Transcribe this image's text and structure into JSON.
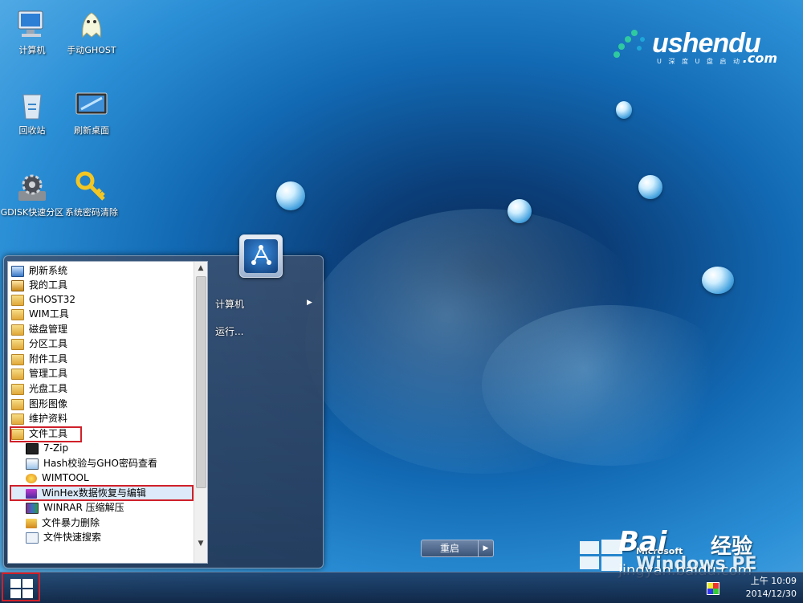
{
  "desktop": {
    "icons": [
      {
        "label": "计算机"
      },
      {
        "label": "手动GHOST"
      },
      {
        "label": "回收站"
      },
      {
        "label": "刷新桌面"
      },
      {
        "label": "GDISK快速分区"
      },
      {
        "label": "系统密码清除"
      }
    ],
    "logo": {
      "word": "ushendu",
      "dotcom": ".com",
      "sub": "U 深 度 U 盘 启 动"
    }
  },
  "start_menu": {
    "programs": [
      {
        "label": "刷新系统"
      },
      {
        "label": "我的工具"
      },
      {
        "label": "GHOST32"
      },
      {
        "label": "WIM工具"
      },
      {
        "label": "磁盘管理"
      },
      {
        "label": "分区工具"
      },
      {
        "label": "附件工具"
      },
      {
        "label": "管理工具"
      },
      {
        "label": "光盘工具"
      },
      {
        "label": "图形图像"
      },
      {
        "label": "维护资料"
      },
      {
        "label": "文件工具"
      },
      {
        "label": "7-Zip"
      },
      {
        "label": "Hash校验与GHO密码查看"
      },
      {
        "label": "WIMTOOL"
      },
      {
        "label": "WinHex数据恢复与编辑"
      },
      {
        "label": "WINRAR 压缩解压"
      },
      {
        "label": "文件暴力删除"
      },
      {
        "label": "文件快速搜索"
      }
    ],
    "right": {
      "computer_label": "计算机",
      "run_label": "运行...",
      "restart_label": "重启"
    }
  },
  "taskbar": {
    "time": "上午 10:09",
    "date": "2014/12/30"
  },
  "watermark": {
    "baidu": "Bai",
    "jingyan": "经验",
    "url": "jingyan.baidu.com",
    "microsoft": "Microsoft",
    "winpe": "Windows PE"
  },
  "colors": {
    "highlight_border": "#d0202a",
    "menu_bg": "#3c506e",
    "taskbar_bg": "#1e3c64"
  }
}
